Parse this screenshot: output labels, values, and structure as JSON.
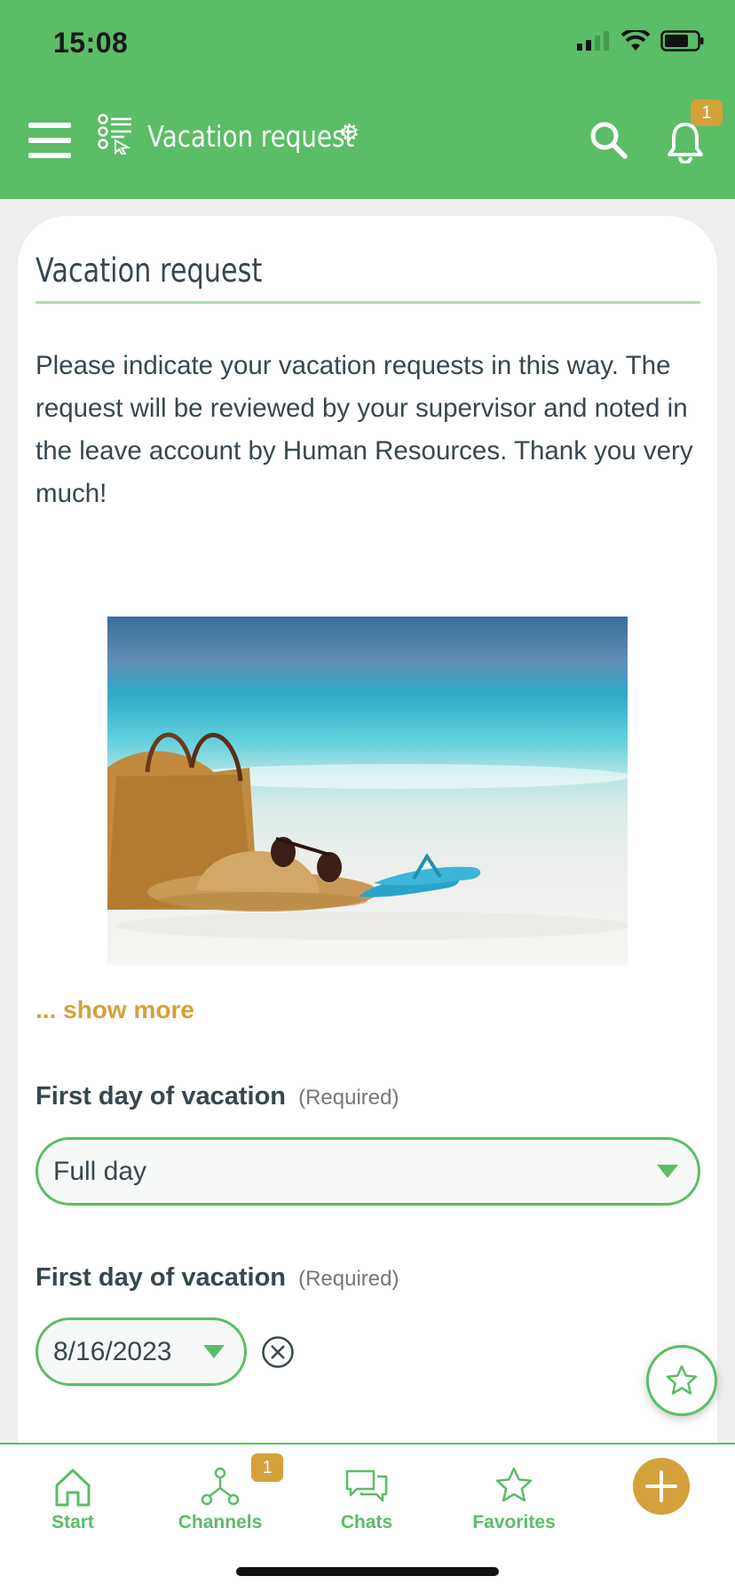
{
  "status_bar": {
    "time": "15:08"
  },
  "app_bar": {
    "title": "Vacation request",
    "notification_count": "1",
    "icons": {
      "menu": "hamburger-icon",
      "form": "form-list-icon",
      "settings": "gear-icon",
      "search": "search-icon",
      "notifications": "bell-icon"
    }
  },
  "form": {
    "heading": "Vacation request",
    "description": "Please indicate your vacation requests in this way. The request will be reviewed by your supervisor and noted in the leave account by Human Resources. Thank you very much!",
    "show_more": "... show more",
    "fields": [
      {
        "label": "First day of vacation",
        "required_note": "(Required)",
        "value": "Full day"
      },
      {
        "label": "First day of vacation",
        "required_note": "(Required)",
        "value": "8/16/2023"
      }
    ]
  },
  "bottom_nav": {
    "items": [
      {
        "label": "Start",
        "icon": "home-icon"
      },
      {
        "label": "Channels",
        "icon": "channels-icon",
        "badge": "1"
      },
      {
        "label": "Chats",
        "icon": "chat-icon"
      },
      {
        "label": "Favorites",
        "icon": "star-icon"
      }
    ],
    "add_icon": "plus-icon"
  },
  "colors": {
    "primary": "#5bbd65",
    "accent": "#d4a13a",
    "text": "#37474f"
  }
}
